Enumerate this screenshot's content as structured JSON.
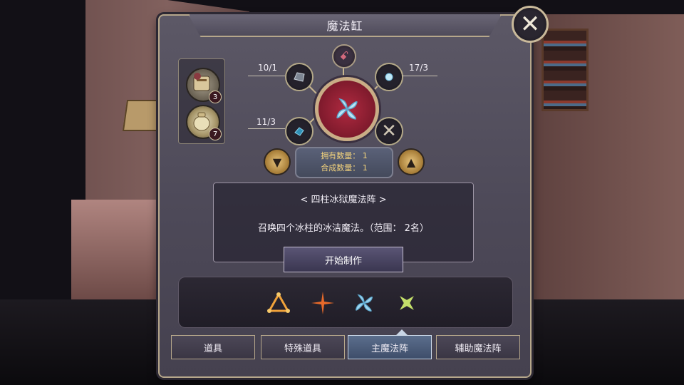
{
  "window": {
    "title": "魔法缸"
  },
  "ingredients": [
    {
      "icon": "scroll-pouch-icon",
      "count": "3"
    },
    {
      "icon": "sack-icon",
      "count": "7"
    }
  ],
  "materials": [
    {
      "icon": "stone-icon",
      "count": "10/1"
    },
    {
      "icon": "orb-icon",
      "count": "17/3"
    },
    {
      "icon": "crystal-icon",
      "count": "11/3"
    },
    {
      "icon": "empty-slot-icon",
      "count": ""
    }
  ],
  "stats": {
    "owned": "拥有数量：  1",
    "crafted": "合成数量：  1"
  },
  "recipe": {
    "name": "< 四柱冰狱魔法阵 >",
    "description": "召唤四个冰柱的冰洁魔法。（范围：  2名）",
    "craft_label": "开始制作"
  },
  "patterns": [
    {
      "icon": "fire-triangle-icon",
      "color": "#f0a23a"
    },
    {
      "icon": "orange-star-icon",
      "color": "#e86a2a"
    },
    {
      "icon": "ice-flower-icon",
      "color": "#9fd6f0"
    },
    {
      "icon": "green-star-icon",
      "color": "#c4e06a"
    }
  ],
  "tabs": [
    {
      "label": "道具"
    },
    {
      "label": "特殊道具"
    },
    {
      "label": "主魔法阵"
    },
    {
      "label": "辅助魔法阵"
    }
  ],
  "colors": {
    "accent": "#c9ad86",
    "orb": "#b02a40",
    "active_tab": "#5b6e8c"
  }
}
